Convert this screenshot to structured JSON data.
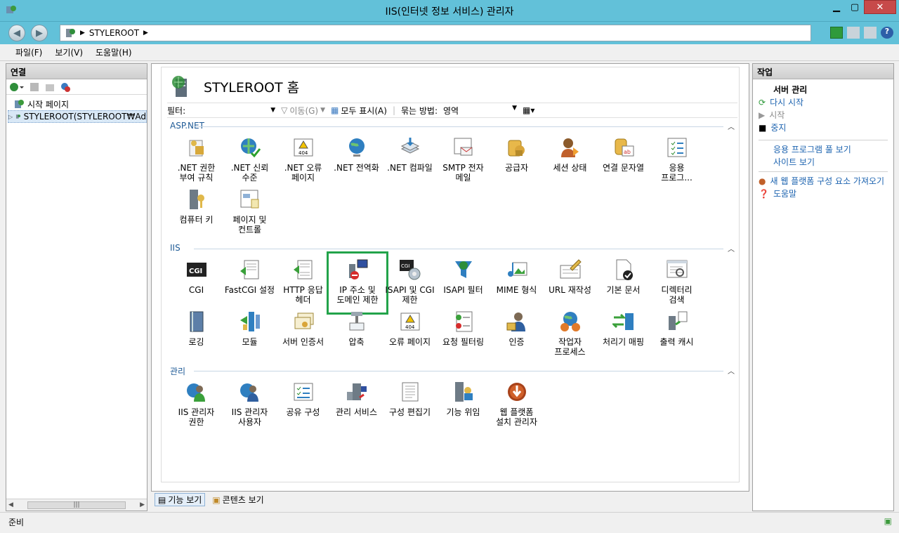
{
  "window": {
    "title": "IIS(인터넷 정보 서비스) 관리자"
  },
  "address": {
    "crumb": "STYLEROOT"
  },
  "menu": [
    "파일(F)",
    "보기(V)",
    "도움말(H)"
  ],
  "connections": {
    "title": "연결",
    "tree": [
      {
        "label": "시작 페이지"
      },
      {
        "label": "STYLEROOT(STYLEROOT₩Ad"
      }
    ]
  },
  "main": {
    "title": "STYLEROOT 홈",
    "filter": {
      "label": "필터:",
      "go": "이동(G)",
      "showall": "모두 표시(A)",
      "groupby": "묶는 방법:",
      "groupval": "영역"
    },
    "groups": [
      {
        "name": "ASP.NET",
        "items": [
          {
            "label": ".NET 권한\n부여 규칙",
            "icon": "authorization-icon"
          },
          {
            "label": ".NET 신뢰\n수준",
            "icon": "trust-icon"
          },
          {
            "label": ".NET 오류\n페이지",
            "icon": "error-page-icon"
          },
          {
            "label": ".NET 전역화",
            "icon": "globe-icon"
          },
          {
            "label": ".NET 컴파일",
            "icon": "compile-icon"
          },
          {
            "label": "SMTP 전자\n메일",
            "icon": "mail-icon"
          },
          {
            "label": "공급자",
            "icon": "provider-icon"
          },
          {
            "label": "세션 상태",
            "icon": "session-icon"
          },
          {
            "label": "연결 문자열",
            "icon": "connection-string-icon"
          },
          {
            "label": "응용\n프로그...",
            "icon": "app-settings-icon"
          },
          {
            "label": "컴퓨터 키",
            "icon": "machine-key-icon"
          },
          {
            "label": "페이지 및\n컨트롤",
            "icon": "pages-controls-icon"
          }
        ]
      },
      {
        "name": "IIS",
        "items": [
          {
            "label": "CGI",
            "icon": "cgi-icon"
          },
          {
            "label": "FastCGI 설정",
            "icon": "fastcgi-icon"
          },
          {
            "label": "HTTP 응답\n헤더",
            "icon": "http-headers-icon"
          },
          {
            "label": "IP 주소 및\n도메인 제한",
            "icon": "ip-restrict-icon",
            "highlight": true
          },
          {
            "label": "ISAPI 및 CGI\n제한",
            "icon": "isapi-cgi-icon"
          },
          {
            "label": "ISAPI 필터",
            "icon": "isapi-filter-icon"
          },
          {
            "label": "MIME 형식",
            "icon": "mime-icon"
          },
          {
            "label": "URL 재작성",
            "icon": "url-rewrite-icon"
          },
          {
            "label": "기본 문서",
            "icon": "default-doc-icon"
          },
          {
            "label": "디렉터리\n검색",
            "icon": "dir-browse-icon"
          },
          {
            "label": "로깅",
            "icon": "logging-icon"
          },
          {
            "label": "모듈",
            "icon": "modules-icon"
          },
          {
            "label": "서버 인증서",
            "icon": "certificate-icon"
          },
          {
            "label": "압축",
            "icon": "compression-icon"
          },
          {
            "label": "오류 페이지",
            "icon": "error-pages-icon"
          },
          {
            "label": "요청 필터링",
            "icon": "request-filter-icon"
          },
          {
            "label": "인증",
            "icon": "authentication-icon"
          },
          {
            "label": "작업자\n프로세스",
            "icon": "worker-process-icon"
          },
          {
            "label": "처리기 매핑",
            "icon": "handler-mapping-icon"
          },
          {
            "label": "출력 캐시",
            "icon": "output-cache-icon"
          }
        ]
      },
      {
        "name": "관리",
        "items": [
          {
            "label": "IIS 관리자\n권한",
            "icon": "manager-perm-icon"
          },
          {
            "label": "IIS 관리자\n사용자",
            "icon": "manager-users-icon"
          },
          {
            "label": "공유 구성",
            "icon": "shared-config-icon"
          },
          {
            "label": "관리 서비스",
            "icon": "management-service-icon"
          },
          {
            "label": "구성 편집기",
            "icon": "config-editor-icon"
          },
          {
            "label": "기능 위임",
            "icon": "feature-delegation-icon"
          },
          {
            "label": "웹 플랫폼\n설치 관리자",
            "icon": "web-platform-icon"
          }
        ]
      }
    ]
  },
  "views": {
    "features": "기능 보기",
    "content": "콘텐츠 보기"
  },
  "actions": {
    "title": "작업",
    "section": "서버 관리",
    "items": [
      {
        "label": "다시 시작",
        "enabled": true,
        "icon": "restart-icon"
      },
      {
        "label": "시작",
        "enabled": false,
        "icon": "start-icon"
      },
      {
        "label": "중지",
        "enabled": true,
        "icon": "stop-icon"
      }
    ],
    "links": [
      "응용 프로그램 풀 보기",
      "사이트 보기"
    ],
    "webplatform": "새 웹 플랫폼 구성 요소 가져오기",
    "help": "도움말"
  },
  "status": "준비",
  "colors": {
    "highlight": "#22a34a",
    "link": "#1e64b0",
    "group": "#1e5a96",
    "chrome": "#62c1d9"
  }
}
